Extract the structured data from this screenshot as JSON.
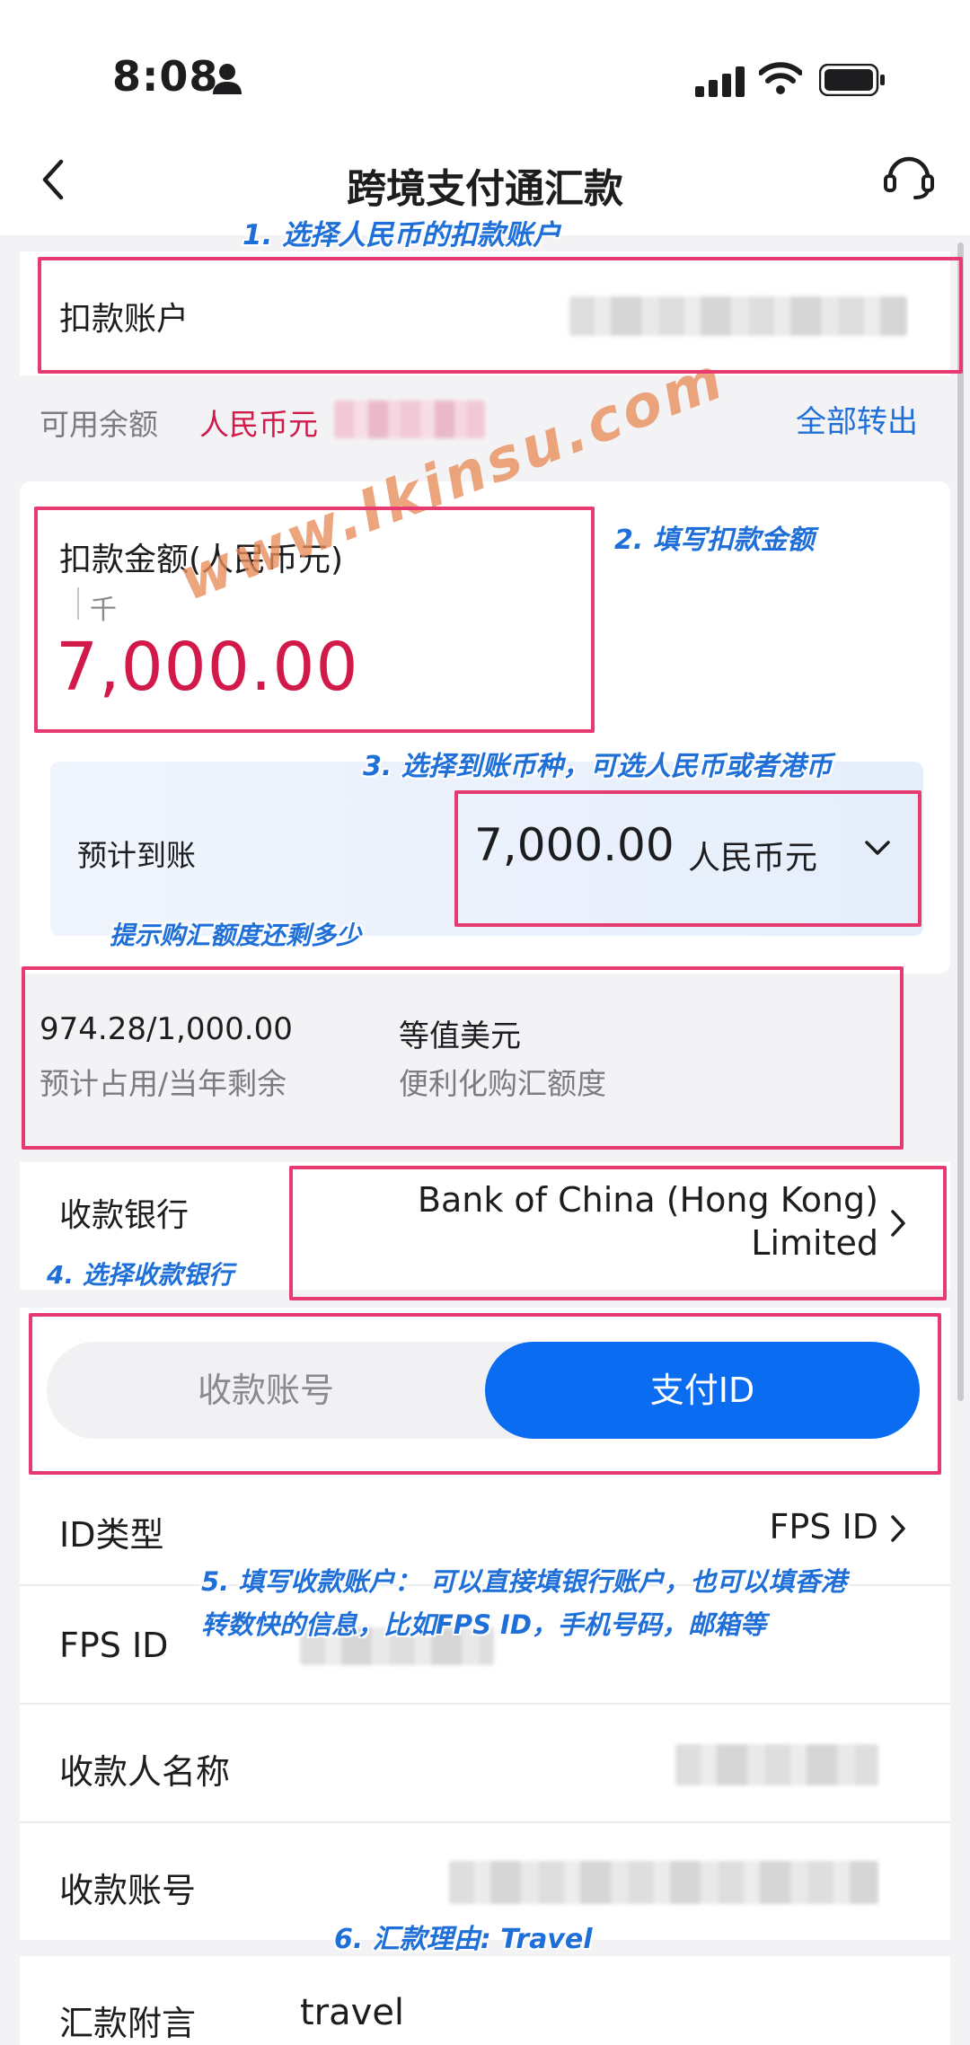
{
  "status_bar": {
    "time": "8:08"
  },
  "header": {
    "title": "跨境支付通汇款"
  },
  "debit_account": {
    "label": "扣款账户"
  },
  "balance": {
    "label": "可用余额",
    "currency": "人民币元",
    "transfer_all": "全部转出"
  },
  "amount": {
    "label": "扣款金额(人民币元)",
    "unit_hint": "千",
    "value": "7,000.00"
  },
  "estimate": {
    "label": "预计到账",
    "value": "7,000.00",
    "currency": "人民币元"
  },
  "quota": {
    "value": "974.28/1,000.00",
    "value_caption": "预计占用/当年剩余",
    "equiv": "等值美元",
    "equiv_caption": "便利化购汇额度"
  },
  "receiving_bank": {
    "label": "收款银行",
    "value_line1": "Bank of China (Hong Kong)",
    "value_line2": "Limited"
  },
  "segment": {
    "left": "收款账号",
    "right": "支付ID",
    "selected": "支付ID"
  },
  "form": {
    "id_type_label": "ID类型",
    "id_type_value": "FPS ID",
    "fps_id_label": "FPS ID",
    "payee_name_label": "收款人名称",
    "payee_account_label": "收款账号",
    "remark_label": "汇款附言",
    "remark_value": "travel"
  },
  "annotations": {
    "note1": "1. 选择人民币的扣款账户",
    "note2": "2. 填写扣款金额",
    "note3": "3. 选择到账币种，可选人民币或者港币",
    "note_quota": "提示购汇额度还剩多少",
    "note4": "4. 选择收款银行",
    "note5_line1": "5. 填写收款账户： 可以直接填银行账户，也可以填香港",
    "note5_line2": "转数快的信息，比如FPS ID，手机号码，邮箱等",
    "note6": "6. 汇款理由: Travel",
    "watermark": "www.Ikinsu.com"
  },
  "colors": {
    "accent_red": "#d21a4a",
    "link_blue": "#1f6fd8",
    "primary_blue": "#0a6cf1",
    "annotation_pink": "#e63a71"
  },
  "icons": [
    "person-icon",
    "signal-icon",
    "wifi-icon",
    "battery-icon",
    "back-icon",
    "headset-icon",
    "chevron-down-icon",
    "chevron-right-icon"
  ]
}
